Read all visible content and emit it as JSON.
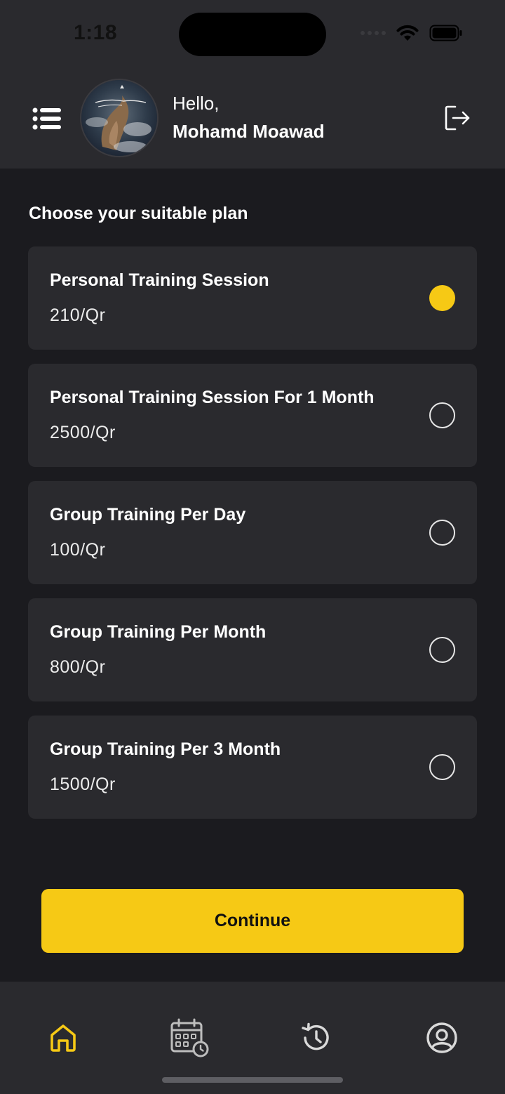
{
  "status_bar": {
    "time": "1:18"
  },
  "header": {
    "greeting": "Hello,",
    "username": "Mohamd Moawad",
    "menu_icon": "menu-list-icon",
    "logout_icon": "logout-icon"
  },
  "main": {
    "title": "Choose your suitable plan",
    "selected_index": 0,
    "plans": [
      {
        "name": "Personal Training Session",
        "price": "210/Qr",
        "selected": true
      },
      {
        "name": "Personal Training Session For 1 Month",
        "price": "2500/Qr",
        "selected": false
      },
      {
        "name": "Group Training Per Day",
        "price": "100/Qr",
        "selected": false
      },
      {
        "name": "Group Training Per Month",
        "price": "800/Qr",
        "selected": false
      },
      {
        "name": "Group Training Per 3 Month",
        "price": "1500/Qr",
        "selected": false
      }
    ],
    "continue_label": "Continue"
  },
  "bottom_nav": {
    "active": "home",
    "items": [
      "home-icon",
      "calendar-schedule-icon",
      "history-icon",
      "profile-icon"
    ]
  },
  "colors": {
    "accent": "#f6c915",
    "background": "#1b1b1f",
    "surface": "#2a2a2e",
    "inactive_icon": "#e6e6e6"
  }
}
